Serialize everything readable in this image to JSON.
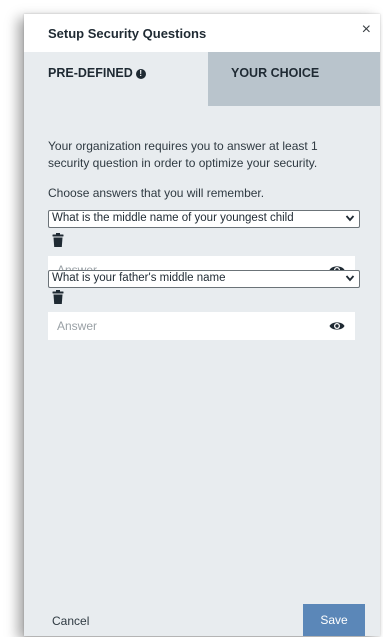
{
  "dialog": {
    "title": "Setup Security Questions",
    "close_label": "×"
  },
  "tabs": [
    {
      "label": "PRE-DEFINED",
      "active": true,
      "info_icon": "info-icon"
    },
    {
      "label": "YOUR CHOICE",
      "active": false
    }
  ],
  "intro": {
    "requirement_text": "Your organization requires you to answer at least 1 security question in order to optimize your security.",
    "choose_text": "Choose answers that you will remember."
  },
  "questions": [
    {
      "selected_question": "What is the middle name of your youngest child",
      "answer_value": "",
      "answer_placeholder": "Answer",
      "delete_icon": "trash-icon",
      "reveal_icon": "eye-icon"
    },
    {
      "selected_question": "What is your father's middle name",
      "answer_value": "",
      "answer_placeholder": "Answer",
      "delete_icon": "trash-icon",
      "reveal_icon": "eye-icon"
    }
  ],
  "footer": {
    "cancel_label": "Cancel",
    "save_label": "Save"
  },
  "colors": {
    "dialog_background": "#e8ecef",
    "inactive_tab": "#b9c4cc",
    "primary_button": "#5b87b8"
  }
}
